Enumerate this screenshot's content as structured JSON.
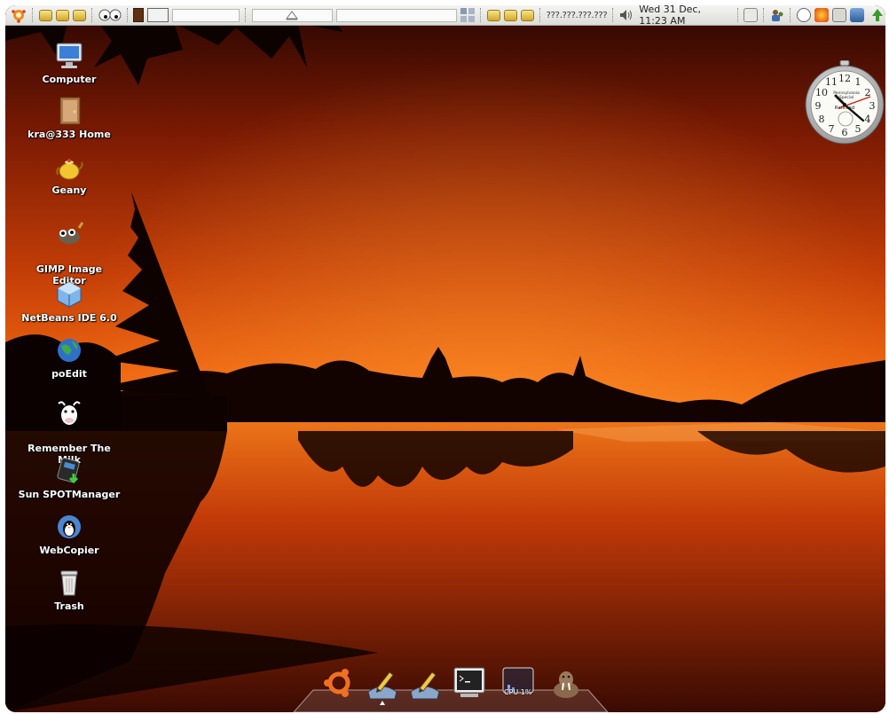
{
  "panel": {
    "ip_address": "???.???.???.???",
    "datetime": "Wed 31 Dec, 11:23 AM",
    "left_launchers": [
      "drawer-icon",
      "drawer-icon",
      "drawer-icon"
    ],
    "right_launchers": [
      "drawer-icon",
      "drawer-icon",
      "drawer-icon"
    ],
    "tray_icons": [
      "update-notifier-icon",
      "user-switcher-icon",
      "power-icon",
      "firefox-icon",
      "mail-icon",
      "network-icon",
      "recycle-icon"
    ]
  },
  "desktop_icons": [
    {
      "label": "Computer",
      "icon": "computer-icon"
    },
    {
      "label": "kra@333 Home",
      "icon": "home-folder-icon"
    },
    {
      "label": "Geany",
      "icon": "geany-teapot-icon"
    },
    {
      "label": "GIMP Image\nEditor",
      "icon": "gimp-icon"
    },
    {
      "label": "NetBeans IDE 6.0",
      "icon": "netbeans-cube-icon"
    },
    {
      "label": "poEdit",
      "icon": "poedit-globe-icon"
    },
    {
      "label": "Remember The\nMilk",
      "icon": "cow-icon"
    },
    {
      "label": "Sun SPOTManager",
      "icon": "sunspot-icon"
    },
    {
      "label": "WebCopier",
      "icon": "webcopier-icon"
    },
    {
      "label": "Trash",
      "icon": "trash-icon"
    }
  ],
  "clock": {
    "brand_line1": "Pennsylvania",
    "brand_line2": "Special",
    "brand_line3": "Railroad",
    "numerals": [
      "12",
      "1",
      "2",
      "3",
      "4",
      "5",
      "6",
      "7",
      "8",
      "9",
      "10",
      "11"
    ]
  },
  "dock": {
    "items": [
      "ubuntu-logo-icon",
      "text-editor-icon",
      "text-editor-icon",
      "terminal-icon",
      "cpu-monitor-icon",
      "walrus-icon"
    ],
    "cpu_label": "CPU 1%"
  },
  "colors": {
    "sky_top": "#3a0a02",
    "sky_mid": "#e0520c",
    "horizon": "#f26a12",
    "water": "#c33a08"
  }
}
